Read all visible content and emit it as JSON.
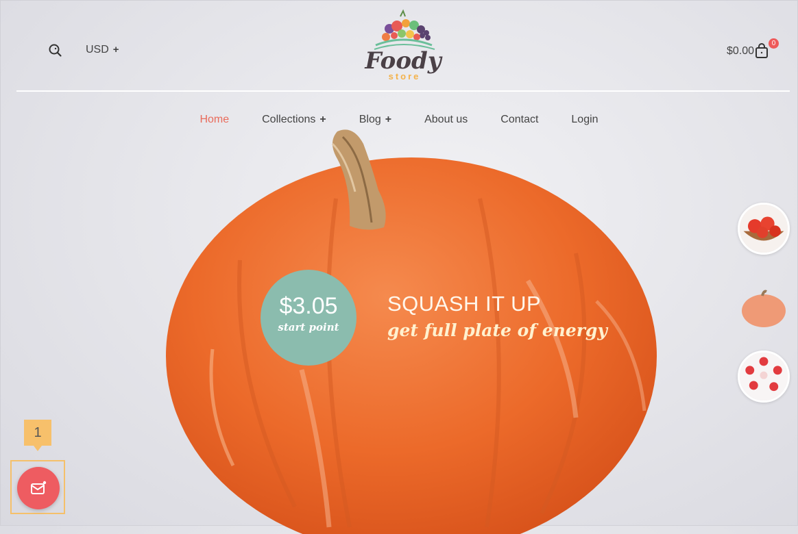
{
  "header": {
    "currency_label": "USD",
    "currency_toggle": "+",
    "logo_primary": "Foody",
    "logo_secondary": "store",
    "cart_total": "$0.00",
    "cart_count": "0"
  },
  "nav": {
    "items": [
      {
        "label": "Home",
        "active": true
      },
      {
        "label": "Collections",
        "expand": "+"
      },
      {
        "label": "Blog",
        "expand": "+"
      },
      {
        "label": "About us"
      },
      {
        "label": "Contact"
      },
      {
        "label": "Login"
      }
    ]
  },
  "hero": {
    "price": "$3.05",
    "price_caption": "start point",
    "title": "SQUASH IT UP",
    "subtitle": "get full plate of energy"
  },
  "thumbnails": [
    "tomatoes",
    "pumpkin",
    "apples"
  ],
  "floating": {
    "step_number": "1"
  },
  "colors": {
    "accent_red": "#ee5c61",
    "nav_active": "#e96b5b",
    "price_circle": "#8bbcae",
    "badge_yellow": "#f7c06b"
  }
}
